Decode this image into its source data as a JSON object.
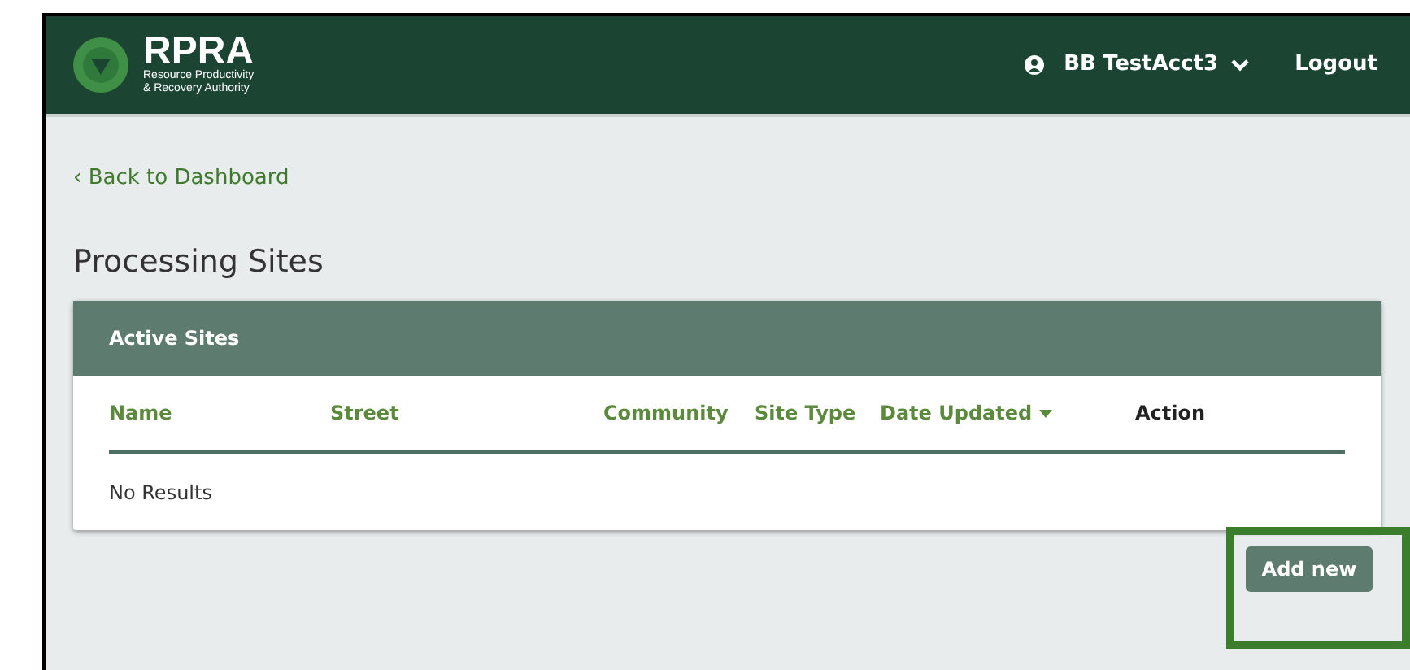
{
  "header": {
    "logo_title": "RPRA",
    "logo_subtitle_1": "Resource Productivity",
    "logo_subtitle_2": "& Recovery Authority",
    "user": "BB TestAcct3",
    "logout": "Logout"
  },
  "back_link": "‹ Back to Dashboard",
  "page_title": "Processing Sites",
  "card": {
    "title": "Active Sites",
    "columns": [
      {
        "label": "Name",
        "sortable": true,
        "sorted": false
      },
      {
        "label": "Street",
        "sortable": true,
        "sorted": false
      },
      {
        "label": "Community",
        "sortable": true,
        "sorted": false
      },
      {
        "label": "Site Type",
        "sortable": true,
        "sorted": false
      },
      {
        "label": "Date Updated",
        "sortable": true,
        "sorted": true
      },
      {
        "label": "Action",
        "sortable": false,
        "sorted": false
      }
    ],
    "empty_message": "No Results"
  },
  "add_button": {
    "label": "Add new",
    "highlighted": true
  }
}
